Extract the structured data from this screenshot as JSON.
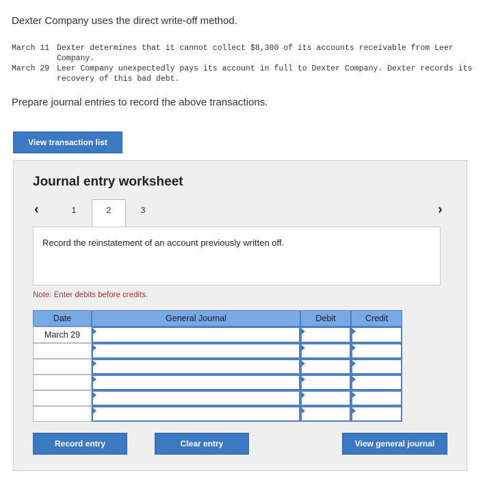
{
  "intro": "Dexter Company uses the direct write-off method.",
  "transactions": [
    {
      "date": "March 11",
      "text": "Dexter determines that it cannot collect $8,300 of its accounts receivable from Leer Company."
    },
    {
      "date": "March 29",
      "text": "Leer Company unexpectedly pays its account in full to Dexter Company. Dexter records its recovery of this bad debt."
    }
  ],
  "prompt": "Prepare journal entries to record the above transactions.",
  "view_transactions_label": "View transaction list",
  "worksheet": {
    "title": "Journal entry worksheet",
    "tabs": [
      "1",
      "2",
      "3"
    ],
    "active_tab": "2",
    "instruction": "Record the reinstatement of an account previously written off.",
    "note": "Note: Enter debits before credits.",
    "columns": [
      "Date",
      "General Journal",
      "Debit",
      "Credit"
    ],
    "first_row_date": "March 29"
  },
  "buttons": {
    "record": "Record entry",
    "clear": "Clear entry",
    "view_journal": "View general journal"
  }
}
